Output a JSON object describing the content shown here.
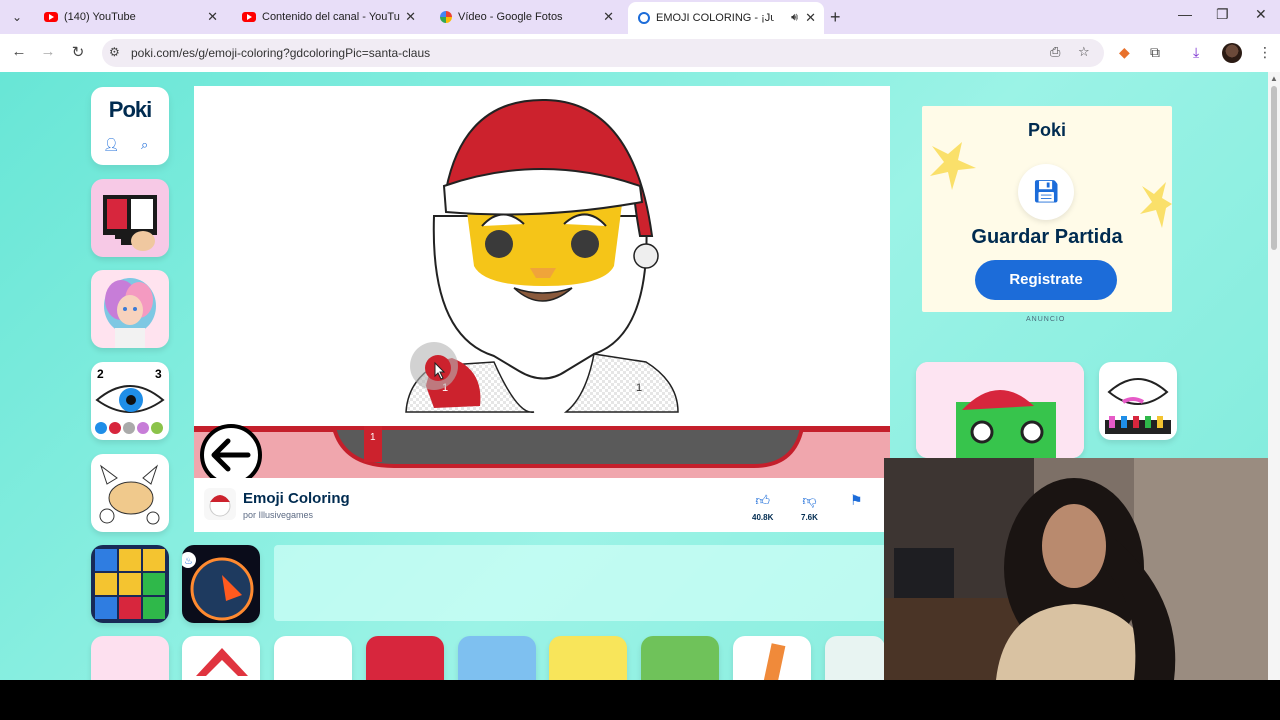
{
  "browser": {
    "tabs": [
      {
        "title": "(140) YouTube",
        "favicon": "youtube-icon",
        "active": false
      },
      {
        "title": "Contenido del canal - YouTube",
        "favicon": "youtube-icon",
        "active": false
      },
      {
        "title": "Vídeo - Google Fotos",
        "favicon": "google-photos-icon",
        "active": false
      },
      {
        "title": "EMOJI COLORING - ¡Juega",
        "favicon": "poki-icon",
        "active": true
      }
    ],
    "url": "poki.com/es/g/emoji-coloring?gdcoloringPic=santa-claus"
  },
  "sidebar": {
    "logo": "Poki"
  },
  "game": {
    "title": "Emoji Coloring",
    "author": "por Illusivegames",
    "likes": "40.8K",
    "dislikes": "7.6K",
    "region_numbers": [
      "1",
      "1"
    ],
    "pencil_number": "1",
    "colors": {
      "santa_red": "#cc222d",
      "face_yellow": "#f5c518",
      "paint_bar": "#f0a6ad",
      "tray": "#5a5a5a"
    }
  },
  "ad": {
    "logo": "Poki",
    "title": "Guardar Partida",
    "button": "Registrate",
    "label": "ANUNCIO"
  },
  "colors": {
    "page_bg": "#7eeadb",
    "brand_blue": "#1c6cd9",
    "brand_navy": "#002b50"
  }
}
